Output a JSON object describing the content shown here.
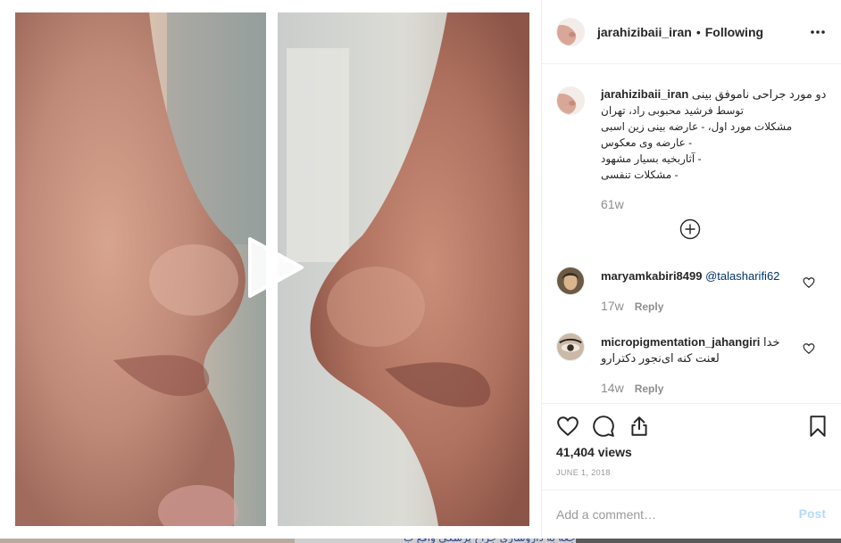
{
  "post": {
    "username": "jarahizibaii_iran",
    "separator": "•",
    "follow_label": "Following",
    "more_icon": "more-options-icon",
    "play_icon": "play-icon",
    "caption": {
      "username": "jarahizibaii_iran",
      "line1": "دو مورد جراحی ناموفق بینی",
      "line2": "توسط فرشید محبوبی راد، تهران",
      "line3": "مشکلات مورد اول، - عارضه بینی زین اسبی",
      "line4": "عارضه وی معکوس -",
      "line5": "آثاربخیه بسیار مشهود -",
      "line6": "مشکلات تنفسی -",
      "time": "61w"
    },
    "load_more_icon": "plus-circle-icon",
    "comments": [
      {
        "username": "maryamkabiri8499",
        "mention": "@talasharifi62",
        "text": "",
        "time": "17w",
        "reply_label": "Reply"
      },
      {
        "username": "micropigmentation_jahangiri",
        "text_inline": "خدا",
        "text_line2": "لعنت کنه ای‌نجور دکترارو",
        "time": "14w",
        "reply_label": "Reply"
      }
    ],
    "views": "41,404 views",
    "date": "JUNE 1, 2018",
    "comment_placeholder": "Add a comment…",
    "post_label": "Post"
  },
  "background": {
    "bottom_blurb": "مراجعه به داروسازی جراح پزشکی واقع ب"
  },
  "colors": {
    "text": "#262626",
    "muted": "#8e8e8e",
    "post_disabled": "#b3dbff",
    "mention": "#003569",
    "border": "#efefef"
  }
}
